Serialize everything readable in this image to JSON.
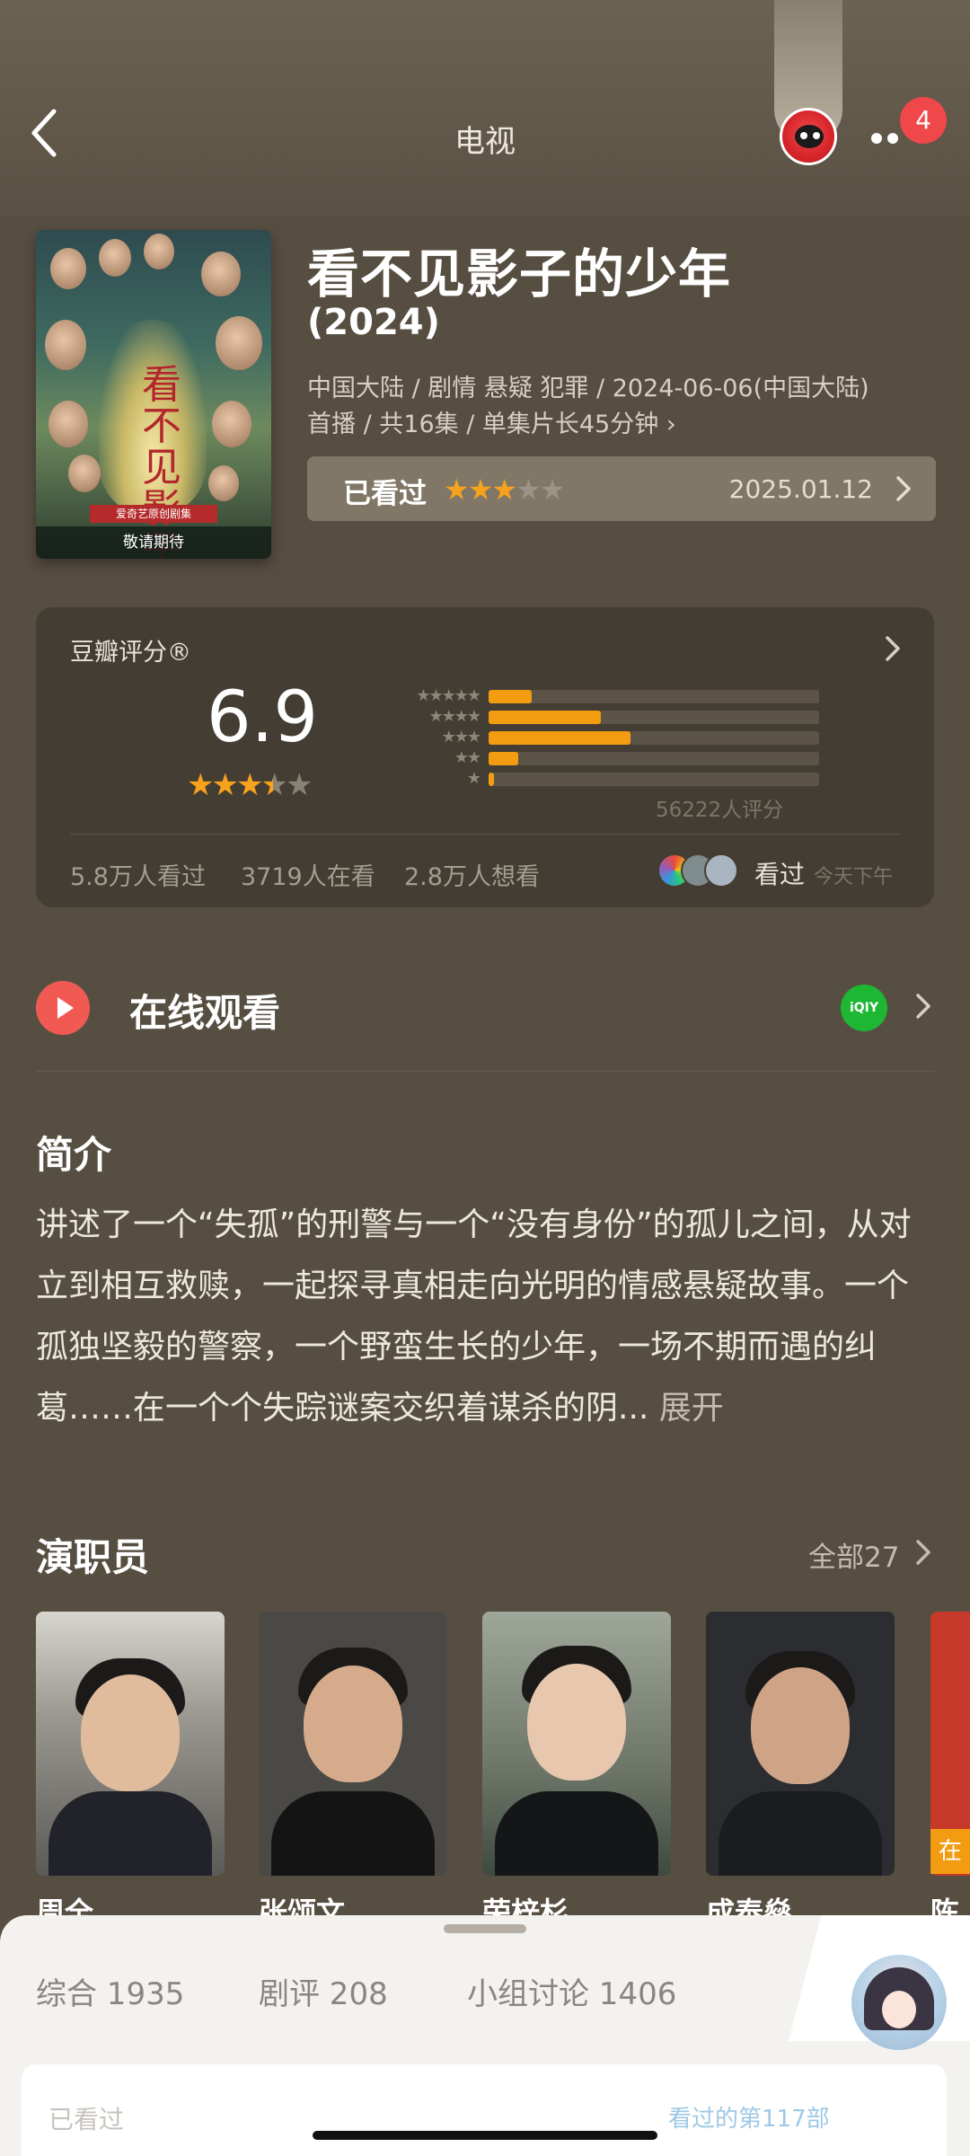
{
  "header": {
    "title": "电视",
    "notification_count": "4"
  },
  "poster": {
    "calligraphy": "看不见影子的少年",
    "band_text": "爱奇艺原创剧集",
    "bottom_text": "敬请期待"
  },
  "show": {
    "title": "看不见影子的少年",
    "year": "(2024)",
    "meta_line1": "中国大陆 / 剧情 悬疑 犯罪 / 2024-06-06(中国大陆)",
    "meta_line2": "首播 / 共16集 / 单集片长45分钟",
    "watched_label": "已看过",
    "user_rating_stars": 3,
    "watched_date": "2025.01.12"
  },
  "rating": {
    "label": "豆瓣评分®",
    "score": "6.9",
    "score_stars": 3.5,
    "distribution": [
      {
        "stars": 5,
        "fraction": 0.13
      },
      {
        "stars": 4,
        "fraction": 0.34
      },
      {
        "stars": 3,
        "fraction": 0.43
      },
      {
        "stars": 2,
        "fraction": 0.09
      },
      {
        "stars": 1,
        "fraction": 0.015
      }
    ],
    "count_text": "56222人评分",
    "watched_count": "5.8万人看过",
    "watching_count": "3719人在看",
    "want_count": "2.8万人想看",
    "friends_status": "看过",
    "friends_time": "今天下午"
  },
  "online": {
    "label": "在线观看",
    "platform_icon": "iqiyi-icon",
    "platform_text": "iQIY"
  },
  "synopsis": {
    "heading": "简介",
    "text": "讲述了一个“失孤”的刑警与一个“没有身份”的孤儿之间，从对立到相互救赎，一起探寻真相走向光明的情感悬疑故事。一个孤独坚毅的警察，一个野蛮生长的少年，一场不期而遇的纠葛……在一个个失踪谜案交织着谋杀的阴...",
    "more": "展开"
  },
  "cast": {
    "heading": "演职员",
    "all_label": "全部27",
    "members": [
      {
        "name": "周全"
      },
      {
        "name": "张颂文"
      },
      {
        "name": "荣梓杉"
      },
      {
        "name": "成泰燊"
      },
      {
        "name": "陈"
      }
    ],
    "partial_tag": "在"
  },
  "sheet": {
    "tabs": [
      "综合 1935",
      "剧评 208",
      "小组讨论 1406"
    ],
    "card_left": "已看过",
    "card_right": "看过的第117部"
  },
  "colors": {
    "background": "#574e42",
    "accent_orange": "#f39c12",
    "badge_red": "#f0474b",
    "play_red": "#f05a52",
    "iqiyi_green": "#1db733"
  }
}
